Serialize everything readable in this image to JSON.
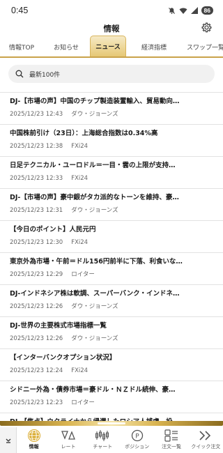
{
  "status_bar": {
    "time": "0:45",
    "battery": "86"
  },
  "header": {
    "title": "情報"
  },
  "tabs": [
    {
      "label": "情報TOP"
    },
    {
      "label": "お知らせ"
    },
    {
      "label": "ニュース",
      "active": true
    },
    {
      "label": "経済指標"
    },
    {
      "label": "スワップ一覧"
    }
  ],
  "search": {
    "placeholder": "最新100件"
  },
  "news": [
    {
      "title": "DJ-【市場の声】中国のチップ製造装置輸入、貿易動向…",
      "datetime": "2025/12/23 12:43",
      "source": "ダウ・ジョーンズ"
    },
    {
      "title": "中国株前引け（23日）：上海総合指数は0.34%高",
      "datetime": "2025/12/23 12:38",
      "source": "FXi24"
    },
    {
      "title": "日足テクニカル・ユーロドル＝一目・雲の上限が支持…",
      "datetime": "2025/12/23 12:33",
      "source": "FXi24"
    },
    {
      "title": "DJ-【市場の声】豪中銀がタカ派的なトーンを維持、豪…",
      "datetime": "2025/12/23 12:31",
      "source": "ダウ・ジョーンズ"
    },
    {
      "title": "【今日のポイント】人民元円",
      "datetime": "2025/12/23 12:30",
      "source": "FXi24"
    },
    {
      "title": "東京外為市場・午前＝ドル156円前半に下落、利食いな…",
      "datetime": "2025/12/23 12:29",
      "source": "ロイター"
    },
    {
      "title": "DJ-インドネシア株は軟調、スーパーバンク・インドネ…",
      "datetime": "2025/12/23 12:26",
      "source": "ダウ・ジョーンズ"
    },
    {
      "title": "DJ-世界の主要株式市場指標一覧",
      "datetime": "2025/12/23 12:26",
      "source": "ダウ・ジョーンズ"
    },
    {
      "title": "【インターバンクオプション状況】",
      "datetime": "2025/12/23 12:24",
      "source": "FXi24"
    },
    {
      "title": "シドニー外為・債券市場＝豪ドル・ＮＺドル続伸、豪…",
      "datetime": "2025/12/23 12:23",
      "source": "ロイター"
    },
    {
      "title": "DJ-【焦点】ウクライナから帰還したロシア人捕虜、投…",
      "datetime": "",
      "source": ""
    }
  ],
  "bottom_nav": [
    {
      "label": "情報",
      "icon": "globe-icon",
      "active": true
    },
    {
      "label": "レート",
      "icon": "rate-icon"
    },
    {
      "label": "チャート",
      "icon": "chart-icon"
    },
    {
      "label": "ポジション",
      "icon": "position-icon"
    },
    {
      "label": "注文一覧",
      "icon": "order-list-icon"
    },
    {
      "label": "クイック注文",
      "icon": "quick-order-icon"
    }
  ],
  "colors": {
    "accent_gold": "#c9a24a",
    "active_tab_bg": "#e6c875",
    "divider": "#e2e2e2"
  }
}
